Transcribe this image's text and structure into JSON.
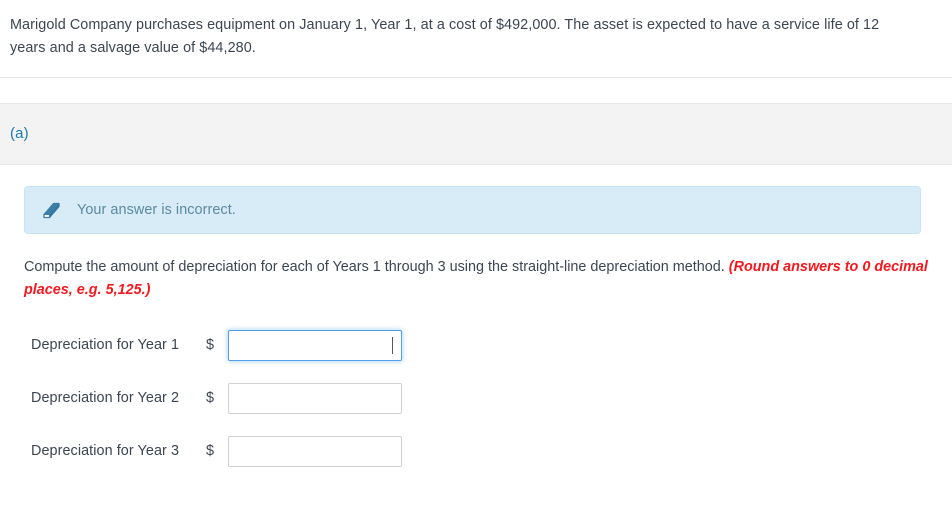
{
  "problem": {
    "statement": "Marigold Company purchases equipment on January 1, Year 1, at a cost of $492,000. The asset is expected to have a service life of 12 years and a salvage value of $44,280."
  },
  "part": {
    "label": "(a)",
    "color": "#1a7bab"
  },
  "alert": {
    "icon": "eraser-icon",
    "message": "Your answer is incorrect.",
    "background": "#d7ecf6",
    "border": "#c6e4f2",
    "text_color": "#5b8aa0"
  },
  "instruction": {
    "main": "Compute the amount of depreciation for each of Years 1 through 3 using the straight-line depreciation method. ",
    "emphasis": "(Round answers to 0 decimal places, e.g. 5,125.)",
    "emphasis_color": "#f5191f"
  },
  "answers": {
    "currency_symbol": "$",
    "rows": [
      {
        "label": "Depreciation for Year 1",
        "value": "",
        "placeholder": "",
        "focused": true
      },
      {
        "label": "Depreciation for Year 2",
        "value": "",
        "placeholder": "",
        "focused": false
      },
      {
        "label": "Depreciation for Year 3",
        "value": "",
        "placeholder": "",
        "focused": false
      }
    ]
  }
}
